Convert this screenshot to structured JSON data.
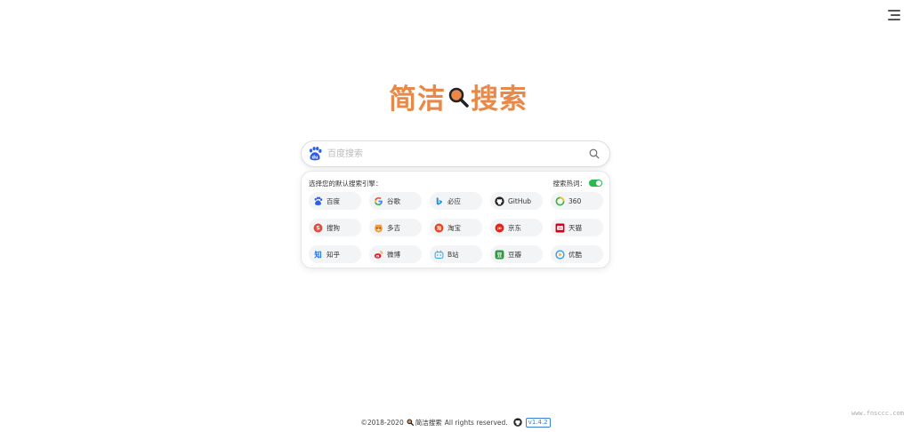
{
  "logo": {
    "text_left": "简洁",
    "text_right": "搜索"
  },
  "search": {
    "placeholder": "百度搜索",
    "value": ""
  },
  "panel": {
    "title": "选择您的默认搜索引擎：",
    "hot_label": "搜索热词：",
    "hot_enabled": true
  },
  "engines": [
    {
      "label": "百度",
      "icon": "baidu-icon",
      "color": "#2f5fe0"
    },
    {
      "label": "谷歌",
      "icon": "google-icon",
      "color": "#4285f4"
    },
    {
      "label": "必应",
      "icon": "bing-icon",
      "color": "#1e8fd6"
    },
    {
      "label": "GitHub",
      "icon": "github-icon",
      "color": "#222222"
    },
    {
      "label": "360",
      "icon": "360-icon",
      "color": "#3cb043"
    },
    {
      "label": "搜狗",
      "icon": "sogou-icon",
      "color": "#e84a3b"
    },
    {
      "label": "多吉",
      "icon": "dogedoge-icon",
      "color": "#f39c34"
    },
    {
      "label": "淘宝",
      "icon": "taobao-icon",
      "color": "#e94320"
    },
    {
      "label": "京东",
      "icon": "jd-icon",
      "color": "#e1251b"
    },
    {
      "label": "天猫",
      "icon": "tmall-icon",
      "color": "#d4001f"
    },
    {
      "label": "知乎",
      "icon": "zhihu-icon",
      "color": "#1772f6"
    },
    {
      "label": "微博",
      "icon": "weibo-icon",
      "color": "#e6162d"
    },
    {
      "label": "B站",
      "icon": "bilibili-icon",
      "color": "#23ade5"
    },
    {
      "label": "豆瓣",
      "icon": "douban-icon",
      "color": "#2e963d"
    },
    {
      "label": "优酷",
      "icon": "youku-icon",
      "color": "#2b9bf4"
    }
  ],
  "footer": {
    "copyright": "©2018-2020",
    "brand": "简洁搜索",
    "rights": "All rights reserved.",
    "version": "v1.4.2"
  },
  "watermark": "www.fnsccc.com",
  "colors": {
    "logo": "#e8894a",
    "toggle_on": "#2db84d",
    "version_badge": "#3a7fd5"
  }
}
